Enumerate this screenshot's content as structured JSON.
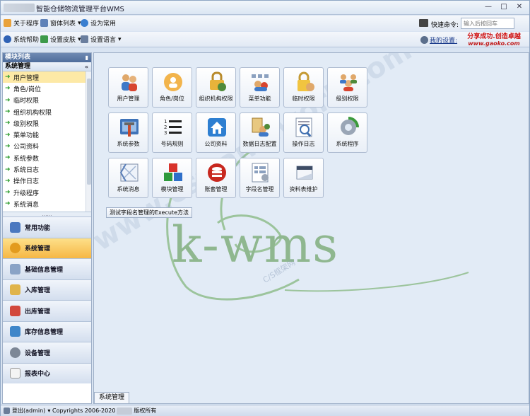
{
  "title": "智能仓储物流管理平台WMS",
  "toolbar1": {
    "about": "关于程序",
    "windows": "窗体列表",
    "favorite": "设为常用",
    "quick_label": "快速命令:",
    "quick_placeholder": "输入后按回车"
  },
  "toolbar2": {
    "help": "系统帮助",
    "skin": "设置皮肤",
    "language": "设置语言",
    "my_settings": "我的设置:",
    "brand_line1": "分享成功.创造卓越",
    "brand_line2": "www.gaoko.com"
  },
  "sidebar": {
    "panel_title": "模块列表",
    "section_title": "系统管理",
    "tree_items": [
      "用户管理",
      "角色/岗位",
      "临时权限",
      "组织机构权限",
      "级别权限",
      "菜单功能",
      "公司资料",
      "系统参数",
      "系统日志",
      "操作日志",
      "升级程序",
      "系统消息"
    ],
    "nav": [
      "常用功能",
      "系统管理",
      "基础信息管理",
      "入库管理",
      "出库管理",
      "库存信息管理",
      "设备管理",
      "报表中心"
    ]
  },
  "main": {
    "tiles": [
      {
        "label": "用户管理",
        "icon": "users-icon"
      },
      {
        "label": "角色/岗位",
        "icon": "user-role-icon"
      },
      {
        "label": "组织机构权限",
        "icon": "org-permission-icon"
      },
      {
        "label": "菜单功能",
        "icon": "menu-icon"
      },
      {
        "label": "临时权限",
        "icon": "lock-icon"
      },
      {
        "label": "级别权限",
        "icon": "level-permission-icon"
      },
      {
        "label": "系统参数",
        "icon": "tools-icon"
      },
      {
        "label": "号码规则",
        "icon": "numbered-list-icon"
      },
      {
        "label": "公司资料",
        "icon": "home-icon"
      },
      {
        "label": "数据日志配置",
        "icon": "data-log-icon"
      },
      {
        "label": "操作日志",
        "icon": "log-search-icon"
      },
      {
        "label": "系统程序",
        "icon": "system-program-icon"
      },
      {
        "label": "系统消息",
        "icon": "message-icon"
      },
      {
        "label": "模块管理",
        "icon": "modules-icon"
      },
      {
        "label": "账套管理",
        "icon": "database-icon"
      },
      {
        "label": "字段名管理",
        "icon": "field-name-icon"
      },
      {
        "label": "资料表维护",
        "icon": "table-maintain-icon"
      }
    ],
    "test_button": "测试字段名管理的Execute方法",
    "tab": "系统管理",
    "watermark_logo": "k-wms",
    "watermark_site": "www.csframework.com",
    "watermark_cs": "C/S框架网"
  },
  "status": {
    "user": "登出(admin)",
    "copyright_pre": "Copyrights 2006-2020",
    "copyright_post": "版权所有"
  }
}
